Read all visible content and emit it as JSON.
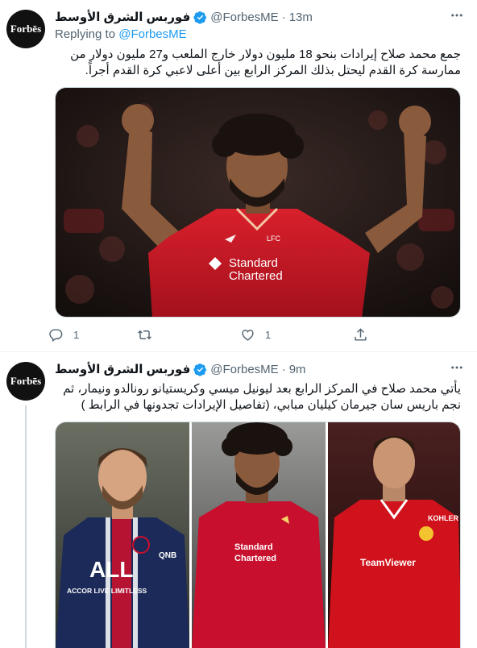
{
  "tweet1": {
    "avatar_text": "Forbēs",
    "display_name": "فوربس الشرق الأوسط",
    "handle": "@ForbesME",
    "separator": "·",
    "time": "13m",
    "replying_prefix": "Replying to ",
    "replying_handle": "@ForbesME",
    "text": "جمع محمد صلاح إيرادات بنحو 18 مليون دولار خارج الملعب و27 مليون دولار من ممارسة كرة القدم ليحتل بذلك المركز الرابع بين أعلى لاعبي كرة القدم أجراً.",
    "image": {
      "sponsor_text_1": "Standard",
      "sponsor_text_2": "Chartered",
      "crest_text": "LFC"
    },
    "actions": {
      "reply_count": "1",
      "retweet_count": "",
      "like_count": "1"
    }
  },
  "tweet2": {
    "avatar_text": "Forbēs",
    "display_name": "فوربس الشرق الأوسط",
    "handle": "@ForbesME",
    "separator": "·",
    "time": "9m",
    "text": "يأتي محمد صلاح في المركز الرابع بعد ليونيل ميسي وكريستيانو رونالدو  ونيمار، ثم نجم باريس سان جيرمان كيليان مبابي، (تفاصيل الإيرادات تجدونها في الرابط )",
    "image": {
      "left_sponsor": "ALL",
      "left_sponsor_sub": "ACCOR LIVE LIMITLESS",
      "left_sleeve": "QNB",
      "mid_sponsor_1": "Standard",
      "mid_sponsor_2": "Chartered",
      "right_sponsor": "TeamViewer",
      "right_sleeve": "KOHLER"
    }
  },
  "colors": {
    "accent": "#1d9bf0",
    "secondary_text": "#536471",
    "liverpool_red": "#c8102e",
    "psg_navy": "#1b2a58"
  }
}
